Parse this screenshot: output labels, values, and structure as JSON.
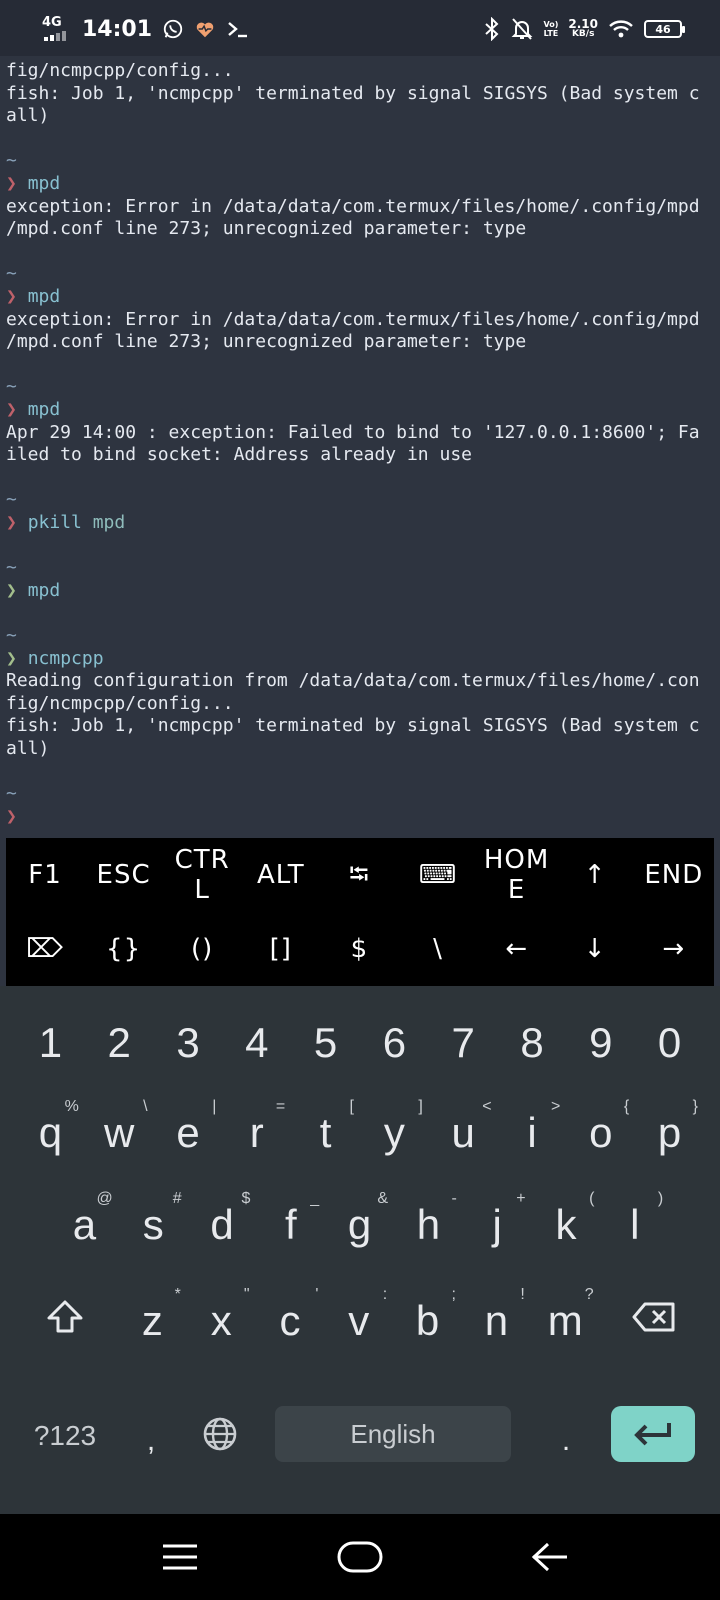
{
  "status_bar": {
    "network": "4G",
    "time": "14:01",
    "volte": "Vo)) LTE",
    "speed_value": "2.10",
    "speed_unit": "KB/s",
    "battery": "46"
  },
  "terminal": {
    "lines": [
      {
        "t": "fig/ncmpcpp/config...",
        "c": "out"
      },
      {
        "t": "fish: Job 1, 'ncmpcpp' terminated by signal SIGSYS (Bad system c",
        "c": "out"
      },
      {
        "t": "all)",
        "c": "out"
      },
      {
        "t": "",
        "c": "out"
      },
      {
        "t": "~",
        "c": "tilde"
      },
      {
        "p": "❯",
        "pc": "red",
        "cmd": "mpd",
        "arg": ""
      },
      {
        "t": "exception: Error in /data/data/com.termux/files/home/.config/mpd",
        "c": "out"
      },
      {
        "t": "/mpd.conf line 273; unrecognized parameter: type",
        "c": "out"
      },
      {
        "t": "",
        "c": "out"
      },
      {
        "t": "~",
        "c": "tilde"
      },
      {
        "p": "❯",
        "pc": "red",
        "cmd": "mpd",
        "arg": ""
      },
      {
        "t": "exception: Error in /data/data/com.termux/files/home/.config/mpd",
        "c": "out"
      },
      {
        "t": "/mpd.conf line 273; unrecognized parameter: type",
        "c": "out"
      },
      {
        "t": "",
        "c": "out"
      },
      {
        "t": "~",
        "c": "tilde"
      },
      {
        "p": "❯",
        "pc": "red",
        "cmd": "mpd",
        "arg": ""
      },
      {
        "t": "Apr 29 14:00 : exception: Failed to bind to '127.0.0.1:8600'; Fa",
        "c": "out"
      },
      {
        "t": "iled to bind socket: Address already in use",
        "c": "out"
      },
      {
        "t": "",
        "c": "out"
      },
      {
        "t": "~",
        "c": "tilde"
      },
      {
        "p": "❯",
        "pc": "red",
        "cmd": "pkill",
        "arg": "mpd"
      },
      {
        "t": "",
        "c": "out"
      },
      {
        "t": "~",
        "c": "tilde"
      },
      {
        "p": "❯",
        "pc": "green",
        "cmd": "mpd",
        "arg": ""
      },
      {
        "t": "",
        "c": "out"
      },
      {
        "t": "~",
        "c": "tilde"
      },
      {
        "p": "❯",
        "pc": "green",
        "cmd": "ncmpcpp",
        "arg": ""
      },
      {
        "t": "Reading configuration from /data/data/com.termux/files/home/.con",
        "c": "out"
      },
      {
        "t": "fig/ncmpcpp/config...",
        "c": "out"
      },
      {
        "t": "fish: Job 1, 'ncmpcpp' terminated by signal SIGSYS (Bad system c",
        "c": "out"
      },
      {
        "t": "all)",
        "c": "out"
      },
      {
        "t": "",
        "c": "out"
      },
      {
        "t": "~",
        "c": "tilde"
      },
      {
        "p": "❯",
        "pc": "red",
        "cmd": "",
        "arg": ""
      }
    ]
  },
  "extra_keys": {
    "row1": [
      "F1",
      "ESC",
      "CTR\nL",
      "ALT",
      "⭾",
      "⌨",
      "HOM\nE",
      "↑",
      "END"
    ],
    "row2": [
      "⌦",
      "{}",
      "()",
      "[]",
      "$",
      "\\",
      "←",
      "↓",
      "→"
    ]
  },
  "keyboard": {
    "numbers": [
      "1",
      "2",
      "3",
      "4",
      "5",
      "6",
      "7",
      "8",
      "9",
      "0"
    ],
    "row_q": [
      {
        "k": "q",
        "h": "%"
      },
      {
        "k": "w",
        "h": "\\"
      },
      {
        "k": "e",
        "h": "|"
      },
      {
        "k": "r",
        "h": "="
      },
      {
        "k": "t",
        "h": "["
      },
      {
        "k": "y",
        "h": "]"
      },
      {
        "k": "u",
        "h": "<"
      },
      {
        "k": "i",
        "h": ">"
      },
      {
        "k": "o",
        "h": "{"
      },
      {
        "k": "p",
        "h": "}"
      }
    ],
    "row_a": [
      {
        "k": "a",
        "h": "@"
      },
      {
        "k": "s",
        "h": "#"
      },
      {
        "k": "d",
        "h": "$"
      },
      {
        "k": "f",
        "h": "_"
      },
      {
        "k": "g",
        "h": "&"
      },
      {
        "k": "h",
        "h": "-"
      },
      {
        "k": "j",
        "h": "+"
      },
      {
        "k": "k",
        "h": "("
      },
      {
        "k": "l",
        "h": ")"
      }
    ],
    "row_z": [
      {
        "k": "z",
        "h": "*"
      },
      {
        "k": "x",
        "h": "\""
      },
      {
        "k": "c",
        "h": "'"
      },
      {
        "k": "v",
        "h": ":"
      },
      {
        "k": "b",
        "h": ";"
      },
      {
        "k": "n",
        "h": "!"
      },
      {
        "k": "m",
        "h": "?"
      }
    ],
    "sym_label": "?123",
    "comma": ",",
    "space_label": "English",
    "period": ".",
    "accent_color": "#7fd3c8"
  }
}
